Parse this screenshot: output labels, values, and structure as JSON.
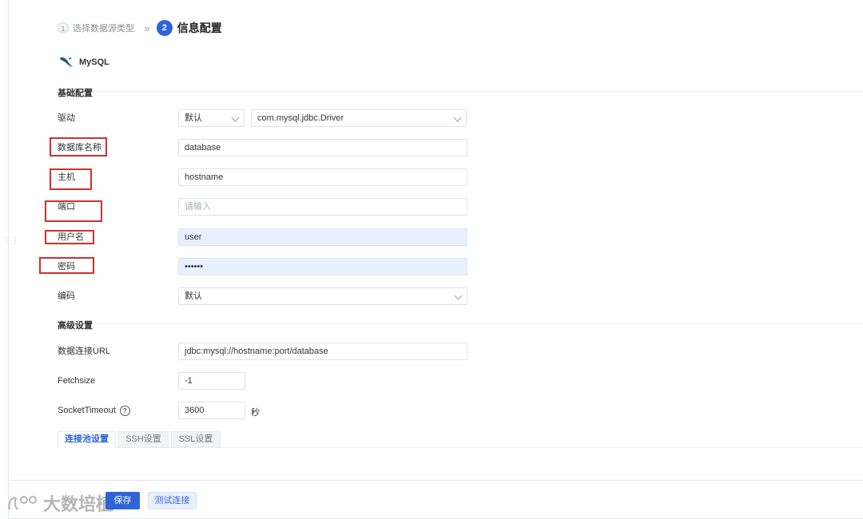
{
  "steps": [
    {
      "num": "1",
      "label": "选择数据源类型"
    },
    {
      "num": "2",
      "label": "信息配置"
    }
  ],
  "step_separator": "»",
  "source": {
    "name": "MySQL",
    "icon": "mysql-dolphin-icon"
  },
  "sections": {
    "basic": "基础配置",
    "advanced": "高级设置"
  },
  "form": {
    "driver": {
      "label": "驱动",
      "type_value": "默认",
      "class_value": "com.mysql.jdbc.Driver"
    },
    "database": {
      "label": "数据库名称",
      "value": "database"
    },
    "host": {
      "label": "主机",
      "value": "hostname"
    },
    "port": {
      "label": "端口",
      "placeholder": "请输入"
    },
    "username": {
      "label": "用户名",
      "value": "user"
    },
    "password": {
      "label": "密码",
      "value": "••••••"
    },
    "encoding": {
      "label": "编码",
      "value": "默认"
    },
    "url": {
      "label": "数据连接URL",
      "value": "jdbc:mysql://hostname:port/database"
    },
    "fetchsize": {
      "label": "Fetchsize",
      "value": "-1"
    },
    "socket_timeout": {
      "label": "SocketTimeout",
      "value": "3600",
      "unit": "秒"
    }
  },
  "tabs": [
    {
      "label": "连接池设置",
      "active": true
    },
    {
      "label": "SSH设置",
      "active": false
    },
    {
      "label": "SSL设置",
      "active": false
    }
  ],
  "buttons": {
    "save": "保存",
    "test": "测试连接"
  },
  "watermark": "大数培植",
  "colors": {
    "primary": "#2f64d8",
    "highlight_border": "#d0302f",
    "autofill_bg": "#e9f0fd"
  }
}
